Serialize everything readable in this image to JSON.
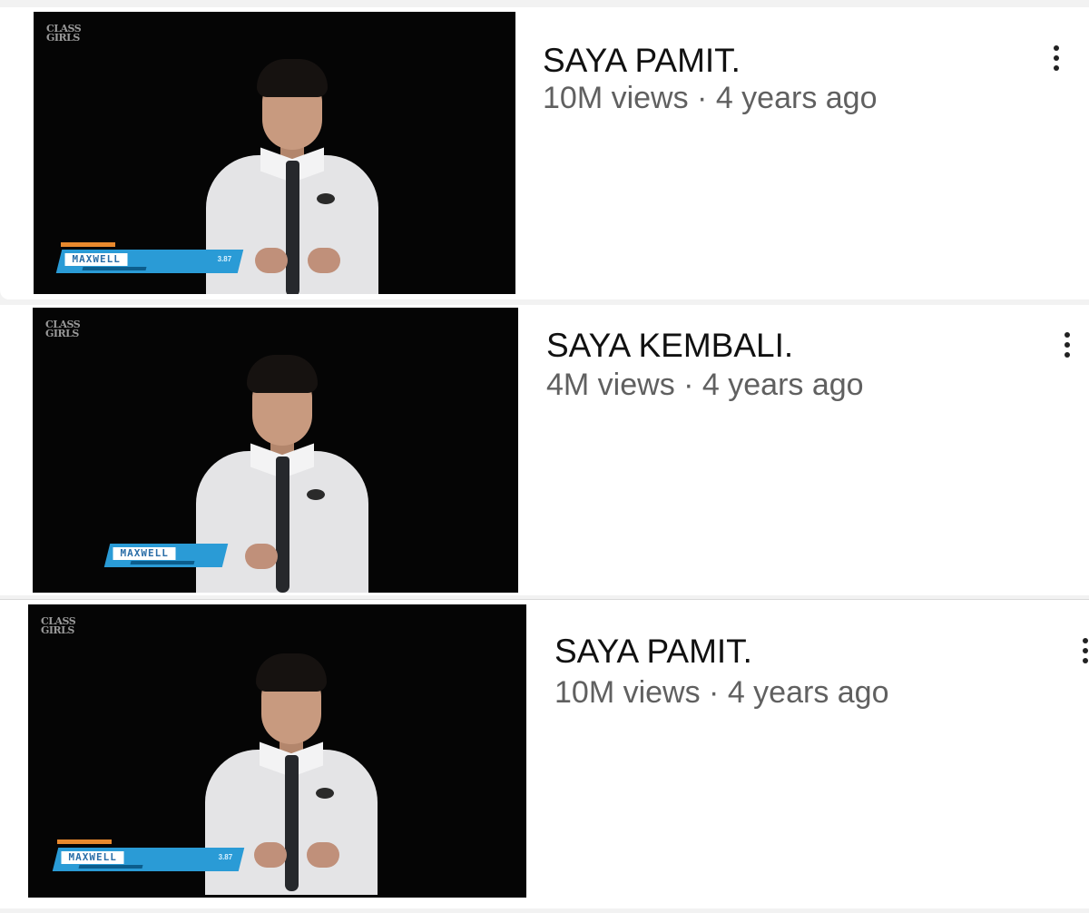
{
  "videos": [
    {
      "title": "SAYA PAMIT.",
      "views": "10M views",
      "age": "4 years ago",
      "separator": " · ",
      "thumbnail": {
        "brand_line1": "CLASS",
        "brand_line2": "GIRLS",
        "lower_third_name": "MAXWELL",
        "lower_third_stat": "3.87"
      }
    },
    {
      "title": "SAYA KEMBALI.",
      "views": "4M views",
      "age": "4 years ago",
      "separator": " · ",
      "thumbnail": {
        "brand_line1": "CLASS",
        "brand_line2": "GIRLS",
        "lower_third_name": "MAXWELL"
      }
    },
    {
      "title": "SAYA PAMIT.",
      "views": "10M views",
      "age": "4 years ago",
      "separator": " · ",
      "thumbnail": {
        "brand_line1": "CLASS",
        "brand_line2": "GIRLS",
        "lower_third_name": "MAXWELL",
        "lower_third_stat": "3.87"
      }
    }
  ],
  "icons": {
    "more": "more-vertical-icon"
  },
  "colors": {
    "title": "#111111",
    "meta": "#606060",
    "thumbnail_bg": "#050505",
    "lower_third": "#2a9bd6"
  }
}
